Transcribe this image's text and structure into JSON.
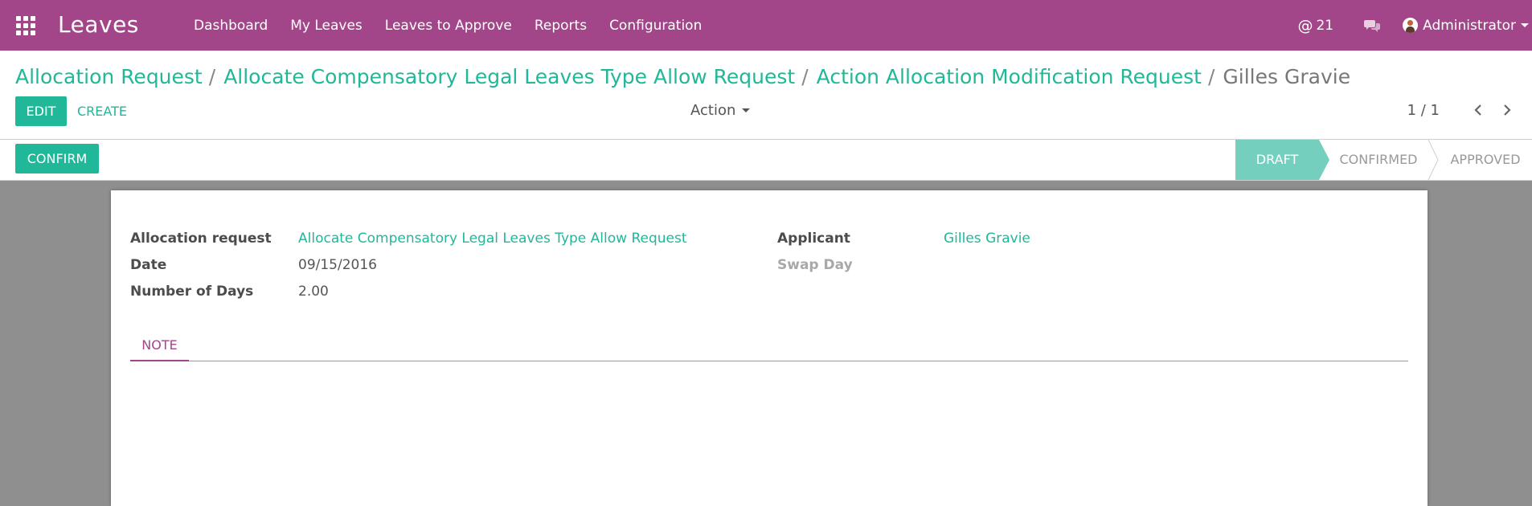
{
  "app": {
    "title": "Leaves"
  },
  "nav": {
    "menu": [
      "Dashboard",
      "My Leaves",
      "Leaves to Approve",
      "Reports",
      "Configuration"
    ],
    "message_count": "21",
    "user_name": "Administrator"
  },
  "breadcrumb": [
    "Allocation Request",
    "Allocate Compensatory Legal Leaves Type Allow Request",
    "Action Allocation Modification Request",
    "Gilles Gravie"
  ],
  "breadcrumb_separator": "/",
  "toolbar": {
    "edit_label": "EDIT",
    "create_label": "CREATE",
    "action_label": "Action",
    "pager_value": "1 / 1"
  },
  "statusbar": {
    "confirm_label": "CONFIRM",
    "stages": [
      "DRAFT",
      "CONFIRMED",
      "APPROVED"
    ],
    "active_stage": "DRAFT"
  },
  "form": {
    "allocation_request_label": "Allocation request",
    "allocation_request_value": "Allocate Compensatory Legal Leaves Type Allow Request",
    "date_label": "Date",
    "date_value": "09/15/2016",
    "days_label": "Number of Days",
    "days_value": "2.00",
    "applicant_label": "Applicant",
    "applicant_value": "Gilles Gravie",
    "swap_day_label": "Swap Day"
  },
  "tabs": {
    "note_label": "NOTE"
  },
  "colors": {
    "brand": "#a24689",
    "accent": "#21b799",
    "stage_active": "#75cfbe"
  },
  "icons": [
    "apps-grid-icon",
    "at-icon",
    "chat-icon",
    "avatar",
    "chevron-left-icon",
    "chevron-right-icon",
    "caret-down-icon"
  ]
}
